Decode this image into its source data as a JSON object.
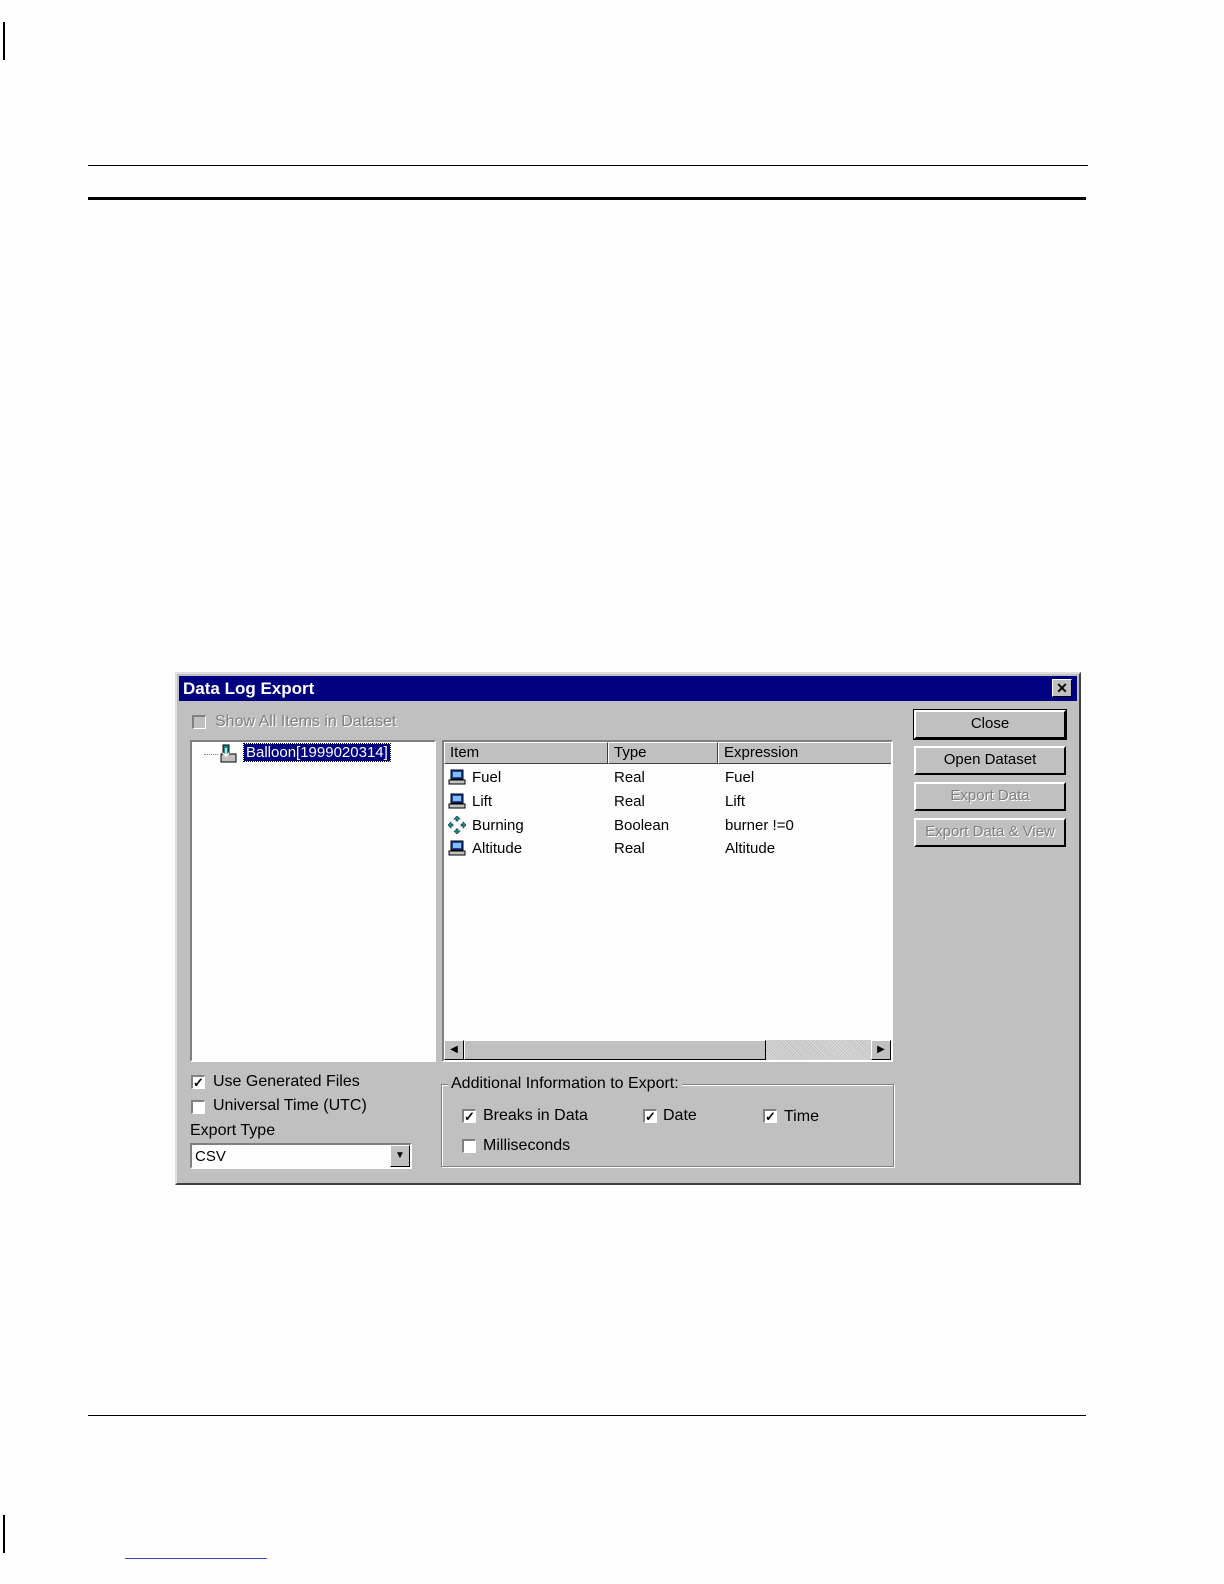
{
  "dialog": {
    "title": "Data Log Export",
    "close_glyph": "✕",
    "show_all_label": "Show All Items in Dataset",
    "tree_root_label": "Balloon[1999020314]",
    "columns": [
      "Item",
      "Type",
      "Expression"
    ],
    "rows": [
      {
        "item": "Fuel",
        "type": "Real",
        "expression": "Fuel",
        "icon": "real-tag-icon"
      },
      {
        "item": "Lift",
        "type": "Real",
        "expression": "Lift",
        "icon": "real-tag-icon"
      },
      {
        "item": "Burning",
        "type": "Boolean",
        "expression": "burner !=0",
        "icon": "boolean-tag-icon"
      },
      {
        "item": "Altitude",
        "type": "Real",
        "expression": "Altitude",
        "icon": "real-tag-icon"
      }
    ],
    "buttons": {
      "close": "Close",
      "open_dataset": "Open Dataset",
      "export_data": "Export Data",
      "export_data_view": "Export Data & View"
    },
    "use_generated_files": {
      "label": "Use Generated Files",
      "checked": true
    },
    "universal_time": {
      "label": "Universal Time (UTC)",
      "checked": false
    },
    "export_type": {
      "label": "Export Type",
      "value": "CSV"
    },
    "additional": {
      "legend": "Additional Information to Export:",
      "breaks": {
        "label": "Breaks in Data",
        "checked": true
      },
      "date": {
        "label": "Date",
        "checked": true
      },
      "time": {
        "label": "Time",
        "checked": true
      },
      "milliseconds": {
        "label": "Milliseconds",
        "checked": false
      }
    }
  }
}
